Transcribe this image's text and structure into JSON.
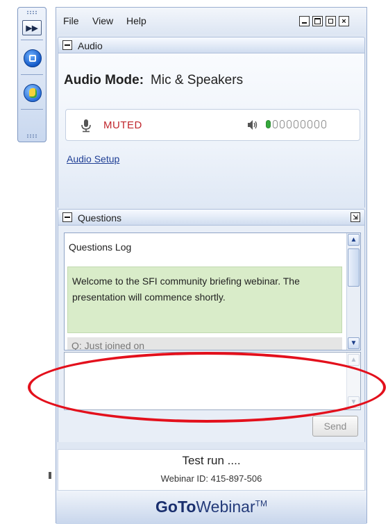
{
  "background": {
    "partial_text": "e"
  },
  "menu": {
    "file": "File",
    "view": "View",
    "help": "Help"
  },
  "audio": {
    "title": "Audio",
    "mode_label": "Audio Mode:",
    "mode_value": "Mic & Speakers",
    "status": "MUTED",
    "level_segments_on": 1,
    "level_segments_total": 9,
    "setup_link": "Audio Setup"
  },
  "questions": {
    "title": "Questions",
    "log_title": "Questions Log",
    "welcome_message": "Welcome to the SFI community briefing webinar. The presentation will commence shortly.",
    "next_entry": "Q: Just joined on",
    "send_label": "Send",
    "input_value": ""
  },
  "footer": {
    "session_title": "Test run ....",
    "webinar_id": "Webinar ID: 415-897-506",
    "brand_bold": "GoTo",
    "brand_rest": "Webinar",
    "brand_tm": "TM"
  },
  "colors": {
    "muted_red": "#c0262c",
    "link_blue": "#1f3f95",
    "welcome_green": "#d9ecc9",
    "annotation_red": "#e3101c"
  },
  "icons": [
    "fast-forward-icon",
    "screen-share-icon",
    "raise-hand-icon",
    "minimize-icon",
    "maximize-icon",
    "popout-icon",
    "close-icon",
    "microphone-icon",
    "speaker-icon",
    "scroll-up-icon",
    "scroll-down-icon"
  ]
}
